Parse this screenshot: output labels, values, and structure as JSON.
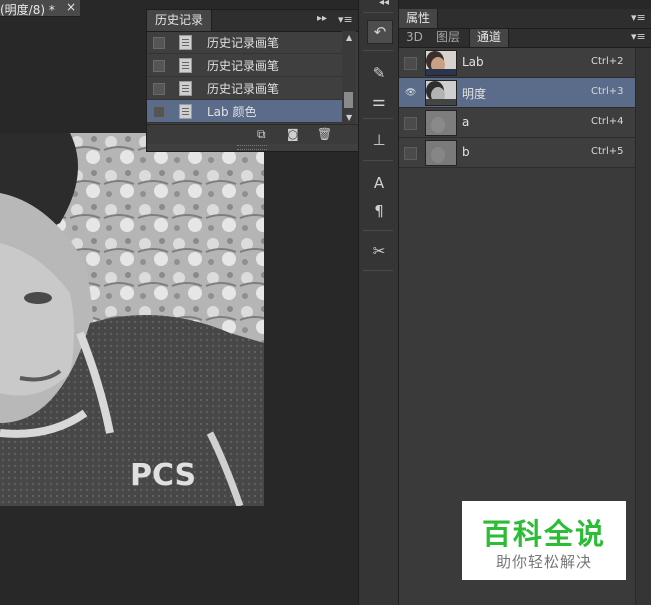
{
  "document_tab": {
    "title": "(明度/8) *",
    "close": "×"
  },
  "history_panel": {
    "title": "历史记录",
    "items": [
      {
        "label": "历史记录画笔",
        "active": false
      },
      {
        "label": "历史记录画笔",
        "active": false
      },
      {
        "label": "历史记录画笔",
        "active": false
      },
      {
        "label": "Lab 颜色",
        "active": true
      }
    ],
    "collapse_icon": "double-chevron-right-icon",
    "menu_icon": "panel-menu-icon",
    "footer_icons": [
      "new-document-from-state-icon",
      "snapshot-camera-icon",
      "trash-icon"
    ]
  },
  "icon_strip": {
    "buttons": [
      "history-icon",
      "brush-presets-icon",
      "adjustments-icon",
      "clone-source-icon",
      "character-icon",
      "paragraph-icon",
      "tools-icon"
    ]
  },
  "properties_panel": {
    "tab_top": "属性",
    "tabs": [
      {
        "label": "3D",
        "active": false
      },
      {
        "label": "图层",
        "active": false
      },
      {
        "label": "通道",
        "active": true
      }
    ],
    "channels": [
      {
        "name": "Lab",
        "shortcut": "Ctrl+2",
        "visible": false,
        "active": false
      },
      {
        "name": "明度",
        "shortcut": "Ctrl+3",
        "visible": true,
        "active": true
      },
      {
        "name": "a",
        "shortcut": "Ctrl+4",
        "visible": false,
        "active": false
      },
      {
        "name": "b",
        "shortcut": "Ctrl+5",
        "visible": false,
        "active": false
      }
    ]
  },
  "watermark": {
    "title": "百科全说",
    "subtitle": "助你轻松解决"
  },
  "colors": {
    "selection": "#5a6c8a",
    "panel_bg": "#3a3a3a",
    "watermark_green": "#2bbd35"
  }
}
